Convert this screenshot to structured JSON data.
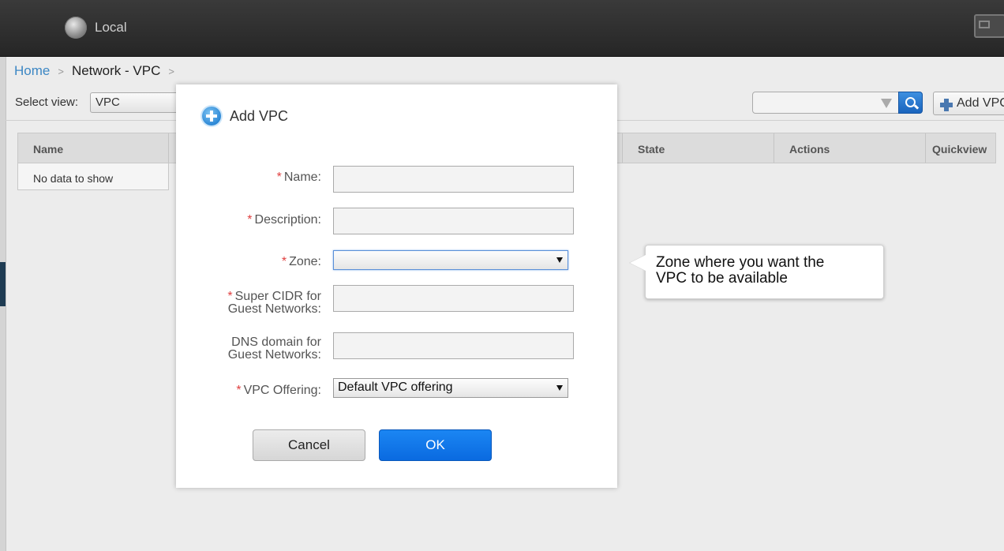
{
  "header": {
    "zone_label": "Local"
  },
  "breadcrumb": {
    "home": "Home",
    "separator": ">",
    "current": "Network - VPC"
  },
  "toolbar": {
    "select_view_label": "Select view:",
    "view_value": "VPC",
    "search_value": "",
    "add_button_label": "Add VPC"
  },
  "table": {
    "columns": [
      "Name",
      "State",
      "Actions",
      "Quickview"
    ],
    "empty_text": "No data to show"
  },
  "dialog": {
    "title": "Add VPC",
    "required_marker": "*",
    "fields": {
      "name": {
        "label": "Name:",
        "value": ""
      },
      "description": {
        "label": "Description:",
        "value": ""
      },
      "zone": {
        "label": "Zone:",
        "value": ""
      },
      "super_cidr": {
        "label_line1": "Super CIDR for",
        "label_line2": "Guest Networks:",
        "value": ""
      },
      "dns_domain": {
        "label_line1": "DNS domain for",
        "label_line2": "Guest Networks:",
        "value": ""
      },
      "vpc_offering": {
        "label": "VPC Offering:",
        "value": "Default VPC offering"
      }
    },
    "cancel_label": "Cancel",
    "ok_label": "OK"
  },
  "tooltip": {
    "line1": "Zone where you want the",
    "line2": "VPC to be available"
  },
  "colors": {
    "topbar": "#2b2b2b",
    "primary_button": "#0d6fe5",
    "link": "#3c87c4",
    "required": "#e04040"
  }
}
